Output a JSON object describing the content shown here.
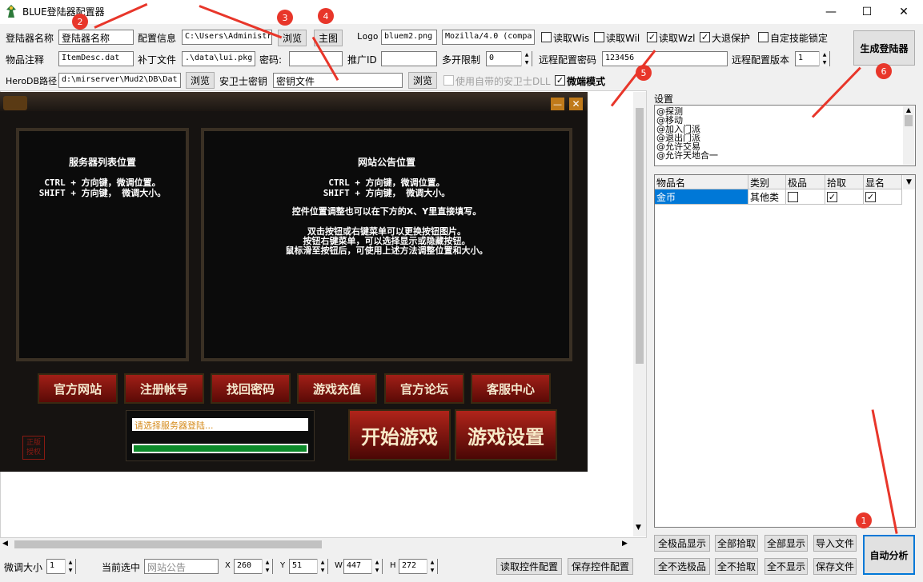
{
  "window": {
    "title": "BLUE登陆器配置器",
    "minimize": "—",
    "maximize": "☐",
    "close": "✕"
  },
  "row1": {
    "launcher_name_label": "登陆器名称",
    "launcher_name_value": "登陆器名称",
    "config_info_label": "配置信息",
    "config_info_value": "C:\\Users\\Administr",
    "browse_label": "浏览",
    "main_image_label": "主图",
    "logo_label": "Logo",
    "logo_value": "bluem2.png",
    "ua_value": "Mozilla/4.0 (compa",
    "read_wis": "读取Wis",
    "read_wil": "读取Wil",
    "read_wzl": "读取Wzl",
    "big_exit": "大退保护",
    "custom_skill": "自定技能锁定",
    "generate_label": "生成登陆器"
  },
  "row2": {
    "item_note_label": "物品注释",
    "item_note_value": "ItemDesc.dat",
    "patch_label": "补丁文件",
    "patch_value": ".\\data\\lui.pkg",
    "password_label": "密码:",
    "promo_label": "推广ID",
    "multi_label": "多开限制",
    "multi_value": "0",
    "remote_pwd_label": "远程配置密码",
    "remote_pwd_value": "123456",
    "remote_ver_label": "远程配置版本",
    "remote_ver_value": "1"
  },
  "row3": {
    "herodb_label": "HeroDB路径",
    "herodb_value": "d:\\mirserver\\Mud2\\DB\\Dat",
    "browse_label": "浏览",
    "guard_label": "安卫士密钥",
    "guard_value": "密钥文件",
    "browse2_label": "浏览",
    "use_dll": "使用自带的安卫士DLL",
    "micro_mode": "微端模式"
  },
  "game": {
    "server_title": "服务器列表位置",
    "server_l1": "CTRL + 方向键，微调位置。",
    "server_l2": "SHIFT + 方向键， 微调大小。",
    "notice_title": "网站公告位置",
    "notice_l1": "CTRL + 方向键，微调位置。",
    "notice_l2": "SHIFT + 方向键， 微调大小。",
    "notice_l3": "控件位置调整也可以在下方的X、Y里直接填写。",
    "notice_l4": "双击按钮或右键菜单可以更换按钮图片。",
    "notice_l5": "按钮右键菜单，可以选择显示或隐藏按钮。",
    "notice_l6": "鼠标滑至按钮后，可使用上述方法调整位置和大小。",
    "buttons": [
      "官方网站",
      "注册帐号",
      "找回密码",
      "游戏充值",
      "官方论坛",
      "客服中心"
    ],
    "status_text": "请选择服务器登陆...",
    "start_game": "开始游戏",
    "game_settings": "游戏设置",
    "seal_text": "正版\n授权"
  },
  "settings": {
    "label": "设置",
    "items": [
      "@探测",
      "@移动",
      "@加入门派",
      "@退出门派",
      "@允许交易",
      "@允许天地合一"
    ]
  },
  "grid": {
    "headers": [
      "物品名",
      "类别",
      "极品",
      "拾取",
      "显名"
    ],
    "rows": [
      {
        "name": "金币",
        "category": "其他类",
        "rare": "",
        "pickup": "✓",
        "show": "✓"
      }
    ]
  },
  "side_buttons": {
    "all_rare_show": "全极品显示",
    "all_pickup": "全部拾取",
    "all_show": "全部显示",
    "import_file": "导入文件",
    "all_not_rare": "全不选极品",
    "none_pickup": "全不拾取",
    "none_show": "全不显示",
    "save_file": "保存文件",
    "auto_analyze": "自动分析"
  },
  "bottom": {
    "fine_tune_label": "微调大小",
    "fine_tune_value": "1",
    "selected_label": "当前选中",
    "selected_value": "网站公告",
    "x_label": "X",
    "x_value": "260",
    "y_label": "Y",
    "y_value": "51",
    "w_label": "W",
    "w_value": "447",
    "h_label": "H",
    "h_value": "272",
    "read_config": "读取控件配置",
    "save_config": "保存控件配置"
  },
  "markers": [
    "1",
    "2",
    "3",
    "4",
    "5",
    "6"
  ],
  "colors": {
    "annotation": "#e8362a",
    "selection": "#0078d7",
    "progress": "#0c8a2a"
  }
}
